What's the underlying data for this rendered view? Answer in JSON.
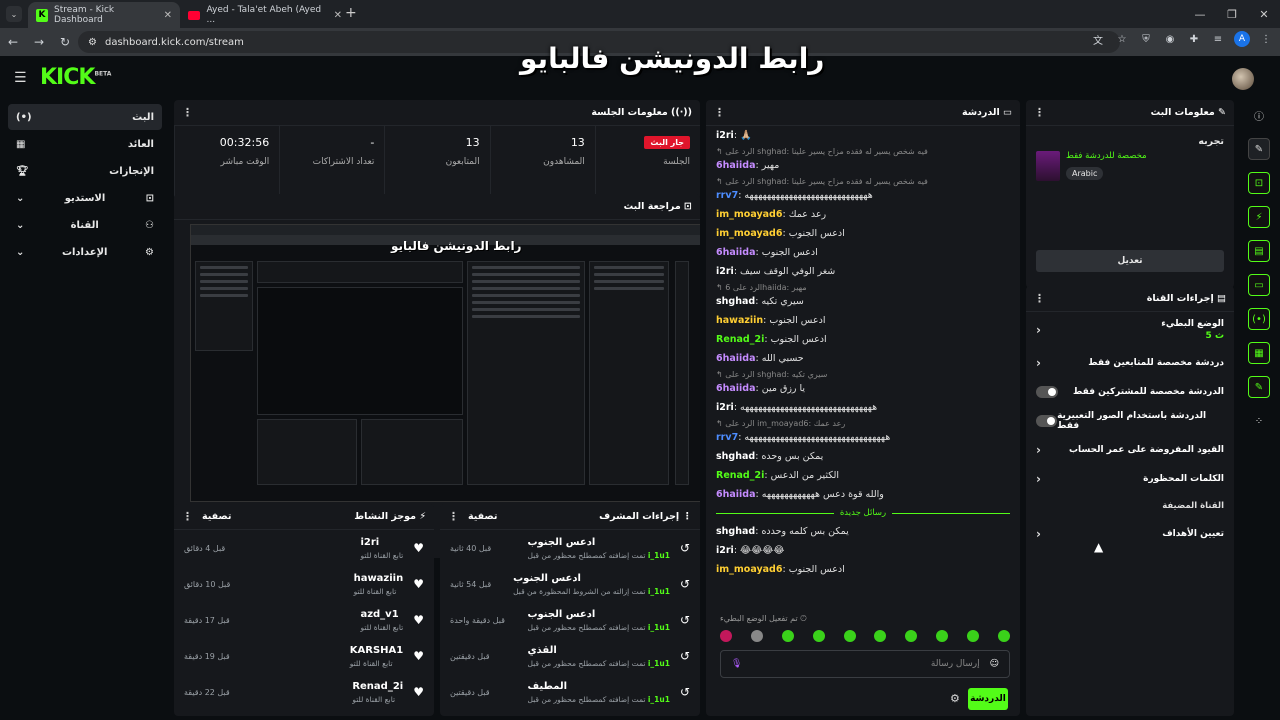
{
  "browser": {
    "tabs": [
      {
        "title": "Stream - Kick Dashboard"
      },
      {
        "title": "Ayed - Tala'et Abeh (Ayed ..."
      }
    ],
    "url": "dashboard.kick.com/stream",
    "profile_initial": "A"
  },
  "overlay_title": "رابط الدونيشن فالبايو",
  "logo": "KICK",
  "logo_tag": "BETA",
  "sidebar": {
    "items": [
      {
        "label": "البث",
        "icon": "broadcast-icon"
      },
      {
        "label": "العائد",
        "icon": "revenue-icon"
      },
      {
        "label": "الإنجازات",
        "icon": "trophy-icon"
      },
      {
        "label": "الاستديو",
        "icon": "studio-icon"
      },
      {
        "label": "القناة",
        "icon": "channel-icon"
      },
      {
        "label": "الإعدادات",
        "icon": "gear-icon"
      }
    ]
  },
  "session": {
    "title": "معلومات الجلسة",
    "badge": "جار البث",
    "badge_label": "الجلسة",
    "stats": [
      {
        "value": "13",
        "label": "المشاهدون"
      },
      {
        "value": "13",
        "label": "المتابعون"
      },
      {
        "value": "-",
        "label": "تعداد الاشتراكات"
      },
      {
        "value": "00:32:56",
        "label": "الوقت مباشر"
      }
    ]
  },
  "preview": {
    "title": "مراجعة البث",
    "inner_title": "رابط الدونيشن فالبايو"
  },
  "activity": {
    "title": "موجز النشاط",
    "filter": "تصفية",
    "rows": [
      {
        "name": "i2ri",
        "sub": "تابع القناة للتو",
        "time": "قبل 4 دقائق"
      },
      {
        "name": "hawaziin",
        "sub": "تابع القناة للتو",
        "time": "قبل 10 دقائق"
      },
      {
        "name": "azd_v1",
        "sub": "تابع القناة للتو",
        "time": "قبل 17 دقيقة"
      },
      {
        "name": "KARSHA1",
        "sub": "تابع القناة للتو",
        "time": "قبل 19 دقيقة"
      },
      {
        "name": "Renad_2i",
        "sub": "تابع القناة للتو",
        "time": "قبل 22 دقيقة"
      }
    ]
  },
  "modactions": {
    "title": "إجراءات المشرف",
    "filter": "تصفية",
    "rows": [
      {
        "name": "ادعس الجنوب",
        "sub": "تمت إضافته كمصطلح محظور من قبل",
        "by": "i_1u1",
        "time": "قبل 40 ثانية"
      },
      {
        "name": "ادعس الجنوب",
        "sub": "تمت إزالته من الشروط المحظورة من قبل",
        "by": "i_1u1",
        "time": "قبل 54 ثانية"
      },
      {
        "name": "ادعس الجنوب",
        "sub": "تمت إضافته كمصطلح محظور من قبل",
        "by": "i_1u1",
        "time": "قبل دقيقة واحدة"
      },
      {
        "name": "القذي",
        "sub": "تمت إضافته كمصطلح محظور من قبل",
        "by": "i_1u1",
        "time": "قبل دقيقتين"
      },
      {
        "name": "المطيف",
        "sub": "تمت إضافته كمصطلح محظور من قبل",
        "by": "i_1u1",
        "time": "قبل دقيقتين"
      }
    ]
  },
  "chat": {
    "title": "الدردشة",
    "messages": [
      {
        "type": "msg",
        "user": "i2ri",
        "color": "#ffffff",
        "text": "🙏🏼"
      },
      {
        "type": "reply",
        "text": "الرد على shghad: فيه شخص يسير له فقده مزاح يسير علينا"
      },
      {
        "type": "msg",
        "user": "6haiida",
        "color": "#c58cff",
        "text": "مهير"
      },
      {
        "type": "reply",
        "text": "الرد على shghad: فيه شخص يسير له فقده مزاح يسير علينا"
      },
      {
        "type": "msg",
        "user": "rrv7",
        "color": "#4d8dff",
        "text": "ههههههههههههههههههههههههههههه"
      },
      {
        "type": "msg",
        "user": "im_moayad6",
        "color": "#ffcf33",
        "text": "رعد عمك"
      },
      {
        "type": "msg",
        "user": "im_moayad6",
        "color": "#ffcf33",
        "text": "ادعس الجنوب"
      },
      {
        "type": "msg",
        "user": "6haiida",
        "color": "#c58cff",
        "text": "ادعس الجنوب"
      },
      {
        "type": "msg",
        "user": "i2ri",
        "color": "#ffffff",
        "text": "شغر الوفي الوقف سيف"
      },
      {
        "type": "reply",
        "text": "الرد على 6haiida: مهير"
      },
      {
        "type": "msg",
        "user": "shghad",
        "color": "#ffffff",
        "text": "سيري تكيه"
      },
      {
        "type": "msg",
        "user": "hawaziin",
        "color": "#ffcf33",
        "text": "ادعس الجنوب"
      },
      {
        "type": "msg",
        "user": "Renad_2i",
        "color": "#53fc18",
        "text": "ادعس الجنوب"
      },
      {
        "type": "msg",
        "user": "6haiida",
        "color": "#c58cff",
        "text": "حسبي الله"
      },
      {
        "type": "reply",
        "text": "الرد على shghad: سيري تكيه"
      },
      {
        "type": "msg",
        "user": "6haiida",
        "color": "#c58cff",
        "text": "يا رزق مين"
      },
      {
        "type": "msg",
        "user": "i2ri",
        "color": "#ffffff",
        "text": "ههههههههههههههههههههههههههههههه"
      },
      {
        "type": "reply",
        "text": "الرد على im_moayad6: رعد عمك"
      },
      {
        "type": "msg",
        "user": "rrv7",
        "color": "#4d8dff",
        "text": "ههههههههههههههههههههههههههههههههه"
      },
      {
        "type": "msg",
        "user": "shghad",
        "color": "#ffffff",
        "text": "يمكن بس وحده"
      },
      {
        "type": "msg",
        "user": "Renad_2i",
        "color": "#53fc18",
        "text": "الكثير من الدعس"
      },
      {
        "type": "msg",
        "user": "6haiida",
        "color": "#c58cff",
        "text": "والله قوة دعس ههههههههههههه"
      },
      {
        "type": "sep",
        "text": "رسائل جديدة"
      },
      {
        "type": "msg",
        "user": "shghad",
        "color": "#ffffff",
        "text": "يمكن بس كلمه وحدده"
      },
      {
        "type": "msg",
        "user": "i2ri",
        "color": "#ffffff",
        "text": "😂😂😂😂"
      },
      {
        "type": "msg",
        "user": "im_moayad6",
        "color": "#ffcf33",
        "text": "ادعس الجنوب"
      }
    ],
    "slow_mode_notice": "تم تفعيل الوضع البطيء",
    "input_placeholder": "إرسال رسالة",
    "send_label": "الدردشة"
  },
  "streaminfo": {
    "title": "معلومات البث",
    "stream_title": "تجربه",
    "category": "مخصصة للدردشة فقط",
    "language": "Arabic",
    "edit_label": "تعديل"
  },
  "channelactions": {
    "title": "إجراءات القناة",
    "slow_mode_label": "الوضع البطيء",
    "slow_mode_value": "5 ث",
    "items": [
      {
        "label": "دردشة مخصصة للمتابعين فقط",
        "control": "chevron"
      },
      {
        "label": "الدردشة مخصصة للمشتركين فقط",
        "control": "toggle"
      },
      {
        "label": "الدردشة باستخدام الصور التعبيرية فقط",
        "control": "toggle"
      },
      {
        "label": "القيود المفروضة على عمر الحساب",
        "control": "chevron"
      },
      {
        "label": "الكلمات المحظورة",
        "control": "chevron"
      }
    ],
    "section_label": "القناة المضيفة",
    "goals_label": "تعيين الأهداف"
  },
  "colors": {
    "accent": "#53fc18",
    "live": "#e0152b"
  }
}
